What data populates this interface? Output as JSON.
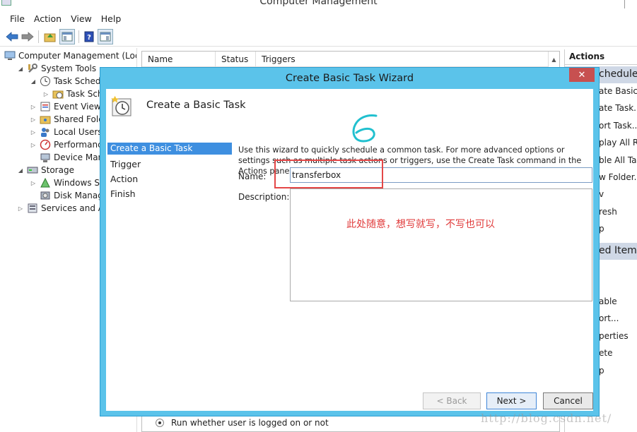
{
  "window": {
    "title": "Computer Management"
  },
  "menu": [
    "File",
    "Action",
    "View",
    "Help"
  ],
  "tree": [
    {
      "label": "Computer Management (Local",
      "level": 0,
      "exp": "",
      "icon": "computer-icon"
    },
    {
      "label": "System Tools",
      "level": 1,
      "exp": "◢",
      "icon": "tools-icon"
    },
    {
      "label": "Task Schedule",
      "level": 2,
      "exp": "◢",
      "icon": "clock-icon"
    },
    {
      "label": "Task Sche",
      "level": 3,
      "exp": "▷",
      "icon": "folder-clock-icon"
    },
    {
      "label": "Event Viewer",
      "level": 2,
      "exp": "▷",
      "icon": "event-viewer-icon"
    },
    {
      "label": "Shared Folder",
      "level": 2,
      "exp": "▷",
      "icon": "shared-folder-icon"
    },
    {
      "label": "Local Users ar",
      "level": 2,
      "exp": "▷",
      "icon": "users-icon"
    },
    {
      "label": "Performance",
      "level": 2,
      "exp": "▷",
      "icon": "performance-icon"
    },
    {
      "label": "Device Manag",
      "level": 2,
      "exp": "",
      "icon": "device-manager-icon"
    },
    {
      "label": "Storage",
      "level": 1,
      "exp": "◢",
      "icon": "storage-icon"
    },
    {
      "label": "Windows Serv",
      "level": 2,
      "exp": "▷",
      "icon": "backup-icon"
    },
    {
      "label": "Disk Manager",
      "level": 2,
      "exp": "",
      "icon": "disk-icon"
    },
    {
      "label": "Services and Appl",
      "level": 1,
      "exp": "▷",
      "icon": "services-icon"
    }
  ],
  "list": {
    "columns": [
      "Name",
      "Status",
      "Triggers"
    ],
    "radio_label": "Run whether user is logged on or not"
  },
  "actions": {
    "header": "Actions",
    "section1": "chedule",
    "items1": [
      "ate Basic",
      "ate Task...",
      "ort Task...",
      "play All Ru",
      "ble All Ta",
      "w Folder...",
      "v",
      "resh",
      "p"
    ],
    "section2": "ed Item",
    "items2": [
      "able",
      "ort...",
      "perties",
      "ete",
      "p"
    ]
  },
  "dialog": {
    "title": "Create Basic Task Wizard",
    "close": "✕",
    "header_title": "Create a Basic Task",
    "steps": [
      "Create a Basic Task",
      "Trigger",
      "Action",
      "Finish"
    ],
    "intro": "Use this wizard to quickly schedule a common task.  For more advanced options or settings such as multiple task actions or triggers, use the Create Task command in the Actions pane.",
    "name_label": "Name:",
    "name_value": "transferbox",
    "desc_label": "Description:",
    "buttons": {
      "back": "< Back",
      "next": "Next >",
      "cancel": "Cancel"
    }
  },
  "annotation": {
    "number": "6",
    "note": "此处随意，想写就写，不写也可以",
    "color": "#e03a3a"
  },
  "watermark": "http://blog.csdn.net/"
}
